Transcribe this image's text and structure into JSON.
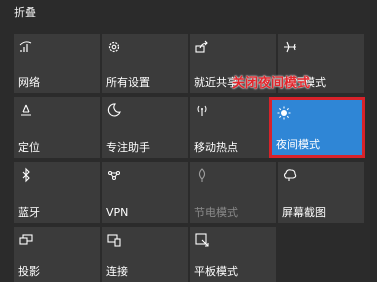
{
  "panel": {
    "collapse_label": "折叠",
    "annotation": "关闭夜间模式"
  },
  "tiles": [
    {
      "label": "网络",
      "icon": "network-icon"
    },
    {
      "label": "所有设置",
      "icon": "gear-icon"
    },
    {
      "label": "就近共享",
      "icon": "nearby-share-icon"
    },
    {
      "label": "飞行模式",
      "icon": "airplane-icon"
    },
    {
      "label": "定位",
      "icon": "location-icon"
    },
    {
      "label": "专注助手",
      "icon": "moon-icon"
    },
    {
      "label": "移动热点",
      "icon": "hotspot-icon"
    },
    {
      "label": "夜间模式",
      "icon": "brightness-icon",
      "state": "on"
    },
    {
      "label": "蓝牙",
      "icon": "bluetooth-icon"
    },
    {
      "label": "VPN",
      "icon": "vpn-icon"
    },
    {
      "label": "节电模式",
      "icon": "leaf-icon",
      "state": "disabled"
    },
    {
      "label": "屏幕截图",
      "icon": "screenshot-icon"
    },
    {
      "label": "投影",
      "icon": "project-icon"
    },
    {
      "label": "连接",
      "icon": "connect-icon"
    },
    {
      "label": "平板模式",
      "icon": "tablet-icon"
    }
  ],
  "colors": {
    "tile_bg": "#3b3b3b",
    "active_tile": "#2f86d6",
    "panel_bg": "#2b2b2b",
    "highlight": "#d8222a"
  }
}
